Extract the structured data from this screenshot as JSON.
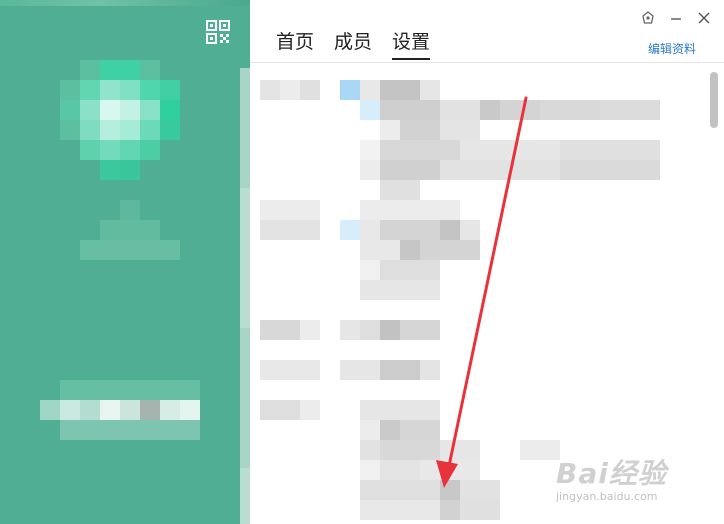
{
  "tabs": [
    {
      "label": "首页",
      "active": false
    },
    {
      "label": "成员",
      "active": false
    },
    {
      "label": "设置",
      "active": true
    }
  ],
  "header": {
    "edit_profile_label": "编辑资料"
  },
  "icons": {
    "qr": "qr-code-icon",
    "skin": "skin-icon",
    "minimize": "minimize-icon",
    "close": "close-icon"
  },
  "colors": {
    "panel_green": "#4fae94",
    "link_blue": "#2d79c7",
    "arrow_red": "#e8323c"
  },
  "watermark": {
    "brand": "Bai经验",
    "sub": "jingyan.baidu.com"
  }
}
